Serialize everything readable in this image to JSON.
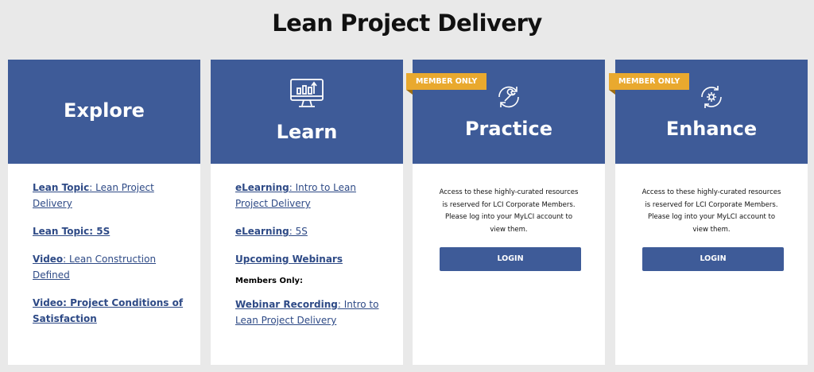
{
  "page": {
    "title": "Lean Project Delivery"
  },
  "cards": {
    "explore": {
      "title": "Explore",
      "links": [
        {
          "strong": "Lean Topic",
          "rest": ": Lean Project Delivery"
        },
        {
          "strong": "Lean Topic: 5S",
          "rest": ""
        },
        {
          "strong": "Video",
          "rest": ": Lean Construction Defined"
        },
        {
          "strong": "Video: Project Conditions of Satisfaction",
          "rest": ""
        }
      ]
    },
    "learn": {
      "title": "Learn",
      "icon": "monitor-chart-icon",
      "links": [
        {
          "strong": "eLearning",
          "rest": ": Intro to Lean Project Delivery"
        },
        {
          "strong": "eLearning",
          "rest": ": 5S"
        },
        {
          "strong": "Upcoming Webinars",
          "rest": ""
        }
      ],
      "members_only_label": "Members Only:",
      "member_links": [
        {
          "strong": "Webinar Recording",
          "rest": ": Intro to Lean Project Delivery"
        }
      ]
    },
    "practice": {
      "title": "Practice",
      "badge": "MEMBER ONLY",
      "icon": "refresh-wrench-icon",
      "notice": "Access to these highly-curated resources is reserved for LCI Corporate Members. Please log into your MyLCI account to view them.",
      "button": "LOGIN"
    },
    "enhance": {
      "title": "Enhance",
      "badge": "MEMBER ONLY",
      "icon": "cycle-gear-icon",
      "notice": "Access to these highly-curated resources is reserved for LCI Corporate Members. Please log into your MyLCI account to view them.",
      "button": "LOGIN"
    }
  },
  "colors": {
    "header_blue": "#3e5b98",
    "badge_gold": "#e9a92e",
    "link_blue": "#2e4a86",
    "background": "#e9e9e9"
  }
}
